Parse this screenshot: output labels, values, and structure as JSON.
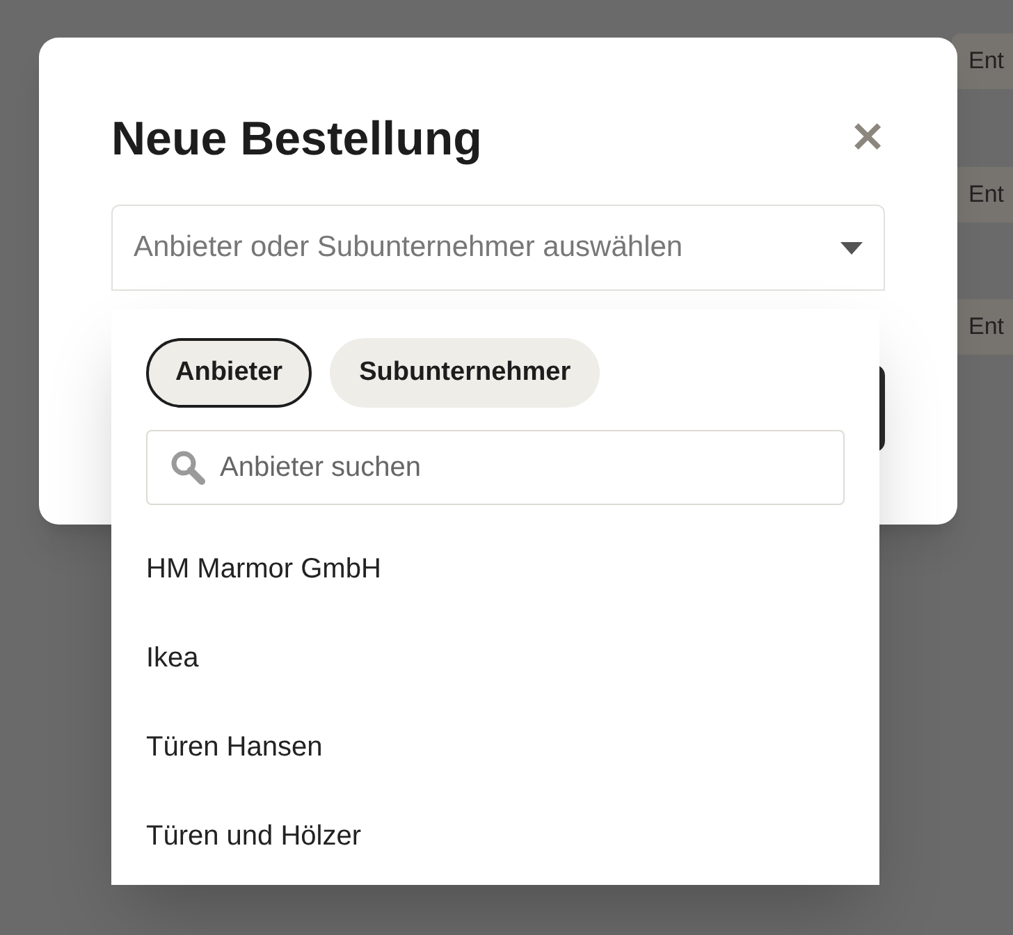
{
  "background": {
    "status_chips": [
      "Ent",
      "Ent",
      "Ent"
    ]
  },
  "dialog": {
    "title": "Neue Bestellung",
    "close": "✕",
    "select": {
      "placeholder": "Anbieter oder Subunternehmer auswählen",
      "expanded": true
    },
    "dropdown": {
      "filters": [
        {
          "label": "Anbieter",
          "selected": true
        },
        {
          "label": "Subunternehmer",
          "selected": false
        }
      ],
      "search": {
        "placeholder": "Anbieter suchen"
      },
      "options": [
        "HM Marmor GmbH",
        "Ikea",
        "Türen Hansen",
        "Türen und Hölzer"
      ]
    }
  }
}
